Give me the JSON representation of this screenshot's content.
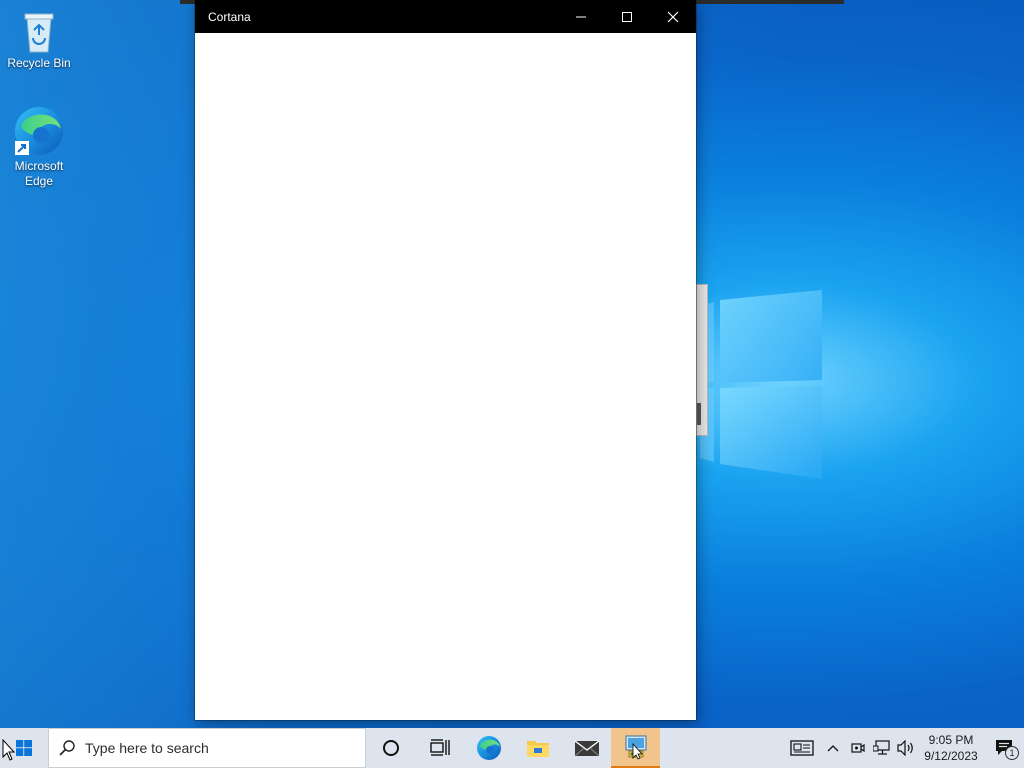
{
  "desktop": {
    "icons": [
      {
        "label": "Recycle Bin",
        "icon": "recycle-bin-icon"
      },
      {
        "label": "Microsoft Edge",
        "icon": "edge-icon"
      }
    ]
  },
  "window": {
    "title": "Cortana",
    "controls": {
      "minimize": "minimize-icon",
      "maximize": "maximize-icon",
      "close": "close-icon"
    }
  },
  "taskbar": {
    "search_placeholder": "Type here to search",
    "apps": [
      {
        "name": "Cortana",
        "icon": "cortana-circle-icon"
      },
      {
        "name": "Task View",
        "icon": "task-view-icon"
      },
      {
        "name": "Microsoft Edge",
        "icon": "edge-icon"
      },
      {
        "name": "File Explorer",
        "icon": "folder-icon"
      },
      {
        "name": "Mail",
        "icon": "mail-icon"
      },
      {
        "name": "Control Panel",
        "icon": "control-panel-icon",
        "active": true
      }
    ],
    "tray": {
      "icons": [
        "news-icon",
        "chevron-up-icon",
        "meet-now-icon",
        "network-icon",
        "volume-icon"
      ],
      "time": "9:05 PM",
      "date": "9/12/2023",
      "notification_count": "1"
    }
  },
  "colors": {
    "taskbar": "#dde4ee",
    "titlebar": "#000000",
    "active_app_highlight": "#f2c48d",
    "desktop_blue": "#0a7fdc"
  }
}
